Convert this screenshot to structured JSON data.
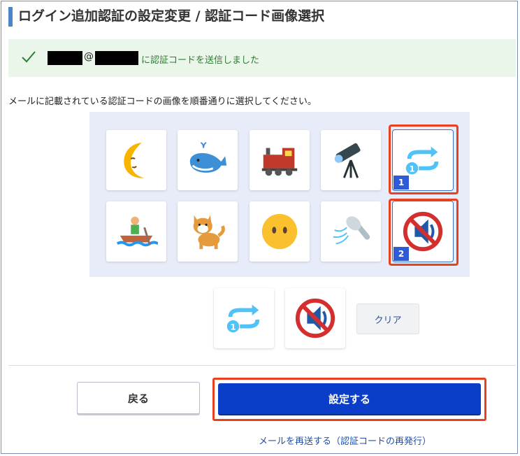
{
  "page": {
    "title": "ログイン追加認証の設定変更 / 認証コード画像選択"
  },
  "notice": {
    "at_sign": "@",
    "message": "に認証コードを送信しました",
    "icon": "check-icon"
  },
  "instruction": "メールに記載されている認証コードの画像を順番通りに選択してください。",
  "image_grid": {
    "tiles": [
      {
        "name": "crescent-moon-face",
        "selected": false
      },
      {
        "name": "whale",
        "selected": false
      },
      {
        "name": "locomotive",
        "selected": false
      },
      {
        "name": "telescope",
        "selected": false
      },
      {
        "name": "repeat-one",
        "selected": true,
        "order": "1"
      },
      {
        "name": "rowboat",
        "selected": false
      },
      {
        "name": "shiba-dog",
        "selected": false
      },
      {
        "name": "face-without-mouth",
        "selected": false
      },
      {
        "name": "shower",
        "selected": false
      },
      {
        "name": "mute",
        "selected": true,
        "order": "2"
      }
    ]
  },
  "selection": {
    "items": [
      "repeat-one",
      "mute"
    ],
    "clear_label": "クリア"
  },
  "actions": {
    "back_label": "戻る",
    "submit_label": "設定する",
    "resend_label": "メールを再送する（認証コードの再発行）"
  },
  "colors": {
    "accent": "#0a3ec9",
    "highlight": "#e8411f",
    "notice_bg": "#eaf6ea",
    "grid_bg": "#e8ecf8",
    "badge": "#2f5bd6"
  }
}
